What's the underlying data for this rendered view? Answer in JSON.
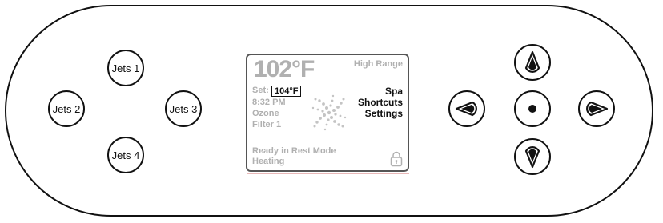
{
  "jets": {
    "jets1_label": "Jets 1",
    "jets2_label": "Jets 2",
    "jets3_label": "Jets 3",
    "jets4_label": "Jets 4"
  },
  "display": {
    "current_temp": "102°F",
    "range": "High Range",
    "set_label": "Set:",
    "set_temp": "104°F",
    "time": "8:32 PM",
    "ozone": "Ozone",
    "filter": "Filter 1",
    "menu": [
      "Spa",
      "Shortcuts",
      "Settings"
    ],
    "status_line1": "Ready in Rest Mode",
    "status_line2": "Heating"
  },
  "icons": {
    "nav_up": "up-arrow-icon",
    "nav_down": "down-arrow-icon",
    "nav_left": "left-arrow-icon",
    "nav_right": "right-arrow-icon",
    "nav_center": "select-dot-icon",
    "swirl": "swirl-logo-icon",
    "lock": "lock-icon"
  },
  "colors": {
    "outline": "#111111",
    "screen_text_dim": "#b0b0b0",
    "screen_text_active": "#111111"
  }
}
